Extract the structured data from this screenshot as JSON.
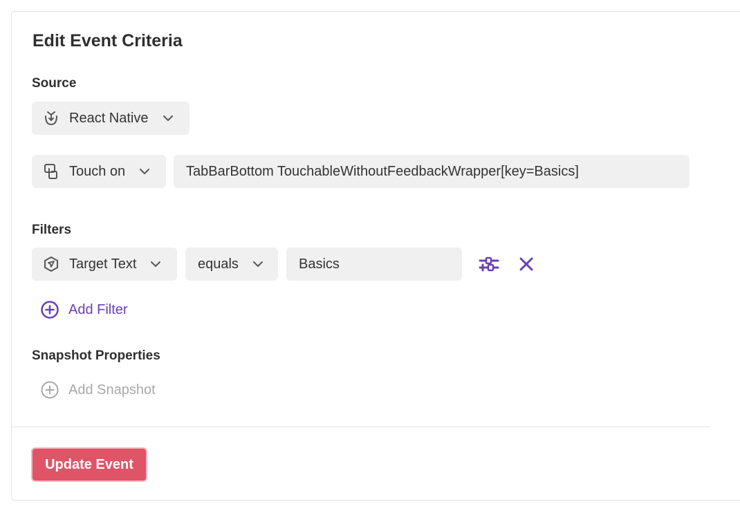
{
  "panel": {
    "title": "Edit Event Criteria"
  },
  "source": {
    "label": "Source",
    "platform": {
      "value": "React Native",
      "icon": "react-native-icon"
    }
  },
  "event": {
    "type": {
      "value": "Touch on",
      "icon": "touch-icon"
    },
    "selector": "TabBarBottom TouchableWithoutFeedbackWrapper[key=Basics]"
  },
  "filters": {
    "label": "Filters",
    "items": [
      {
        "property": {
          "value": "Target Text",
          "icon": "target-icon"
        },
        "operator": "equals",
        "value": "Basics"
      }
    ],
    "add_label": "Add Filter"
  },
  "snapshot": {
    "label": "Snapshot Properties",
    "add_label": "Add Snapshot"
  },
  "footer": {
    "submit_label": "Update Event"
  },
  "colors": {
    "accent": "#6a3fb5",
    "primary": "#e05468",
    "muted": "#a8a8a8"
  }
}
